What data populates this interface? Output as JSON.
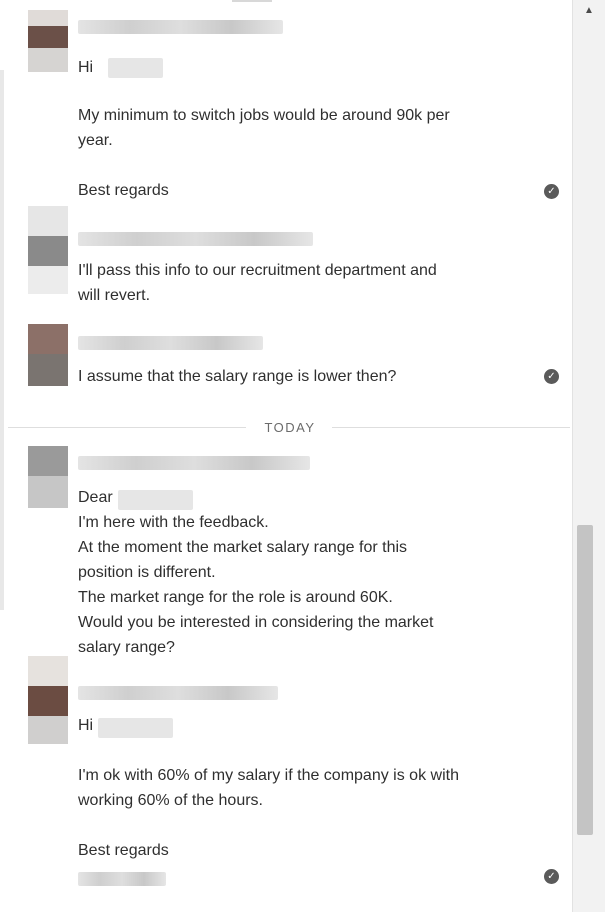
{
  "thread": {
    "messages": [
      {
        "lines": [
          "Hi",
          "",
          "My minimum to switch jobs would be around 90k per",
          "year.",
          "",
          "Best regards"
        ],
        "read": true
      },
      {
        "lines": [
          "I'll pass this info to our recruitment department and",
          "will revert."
        ],
        "read": false
      },
      {
        "lines": [
          "I assume that the salary range is lower then?"
        ],
        "read": true
      },
      {
        "lines": [
          "Dear",
          "I'm here with the feedback.",
          "At the moment the market salary range for this",
          "position is different.",
          "The market range for the role is around 60K.",
          "Would you be interested in considering the market",
          "salary range?"
        ],
        "read": false
      },
      {
        "lines": [
          "Hi",
          "",
          "I'm ok with 60% of my salary if the company is ok with",
          "working 60% of the hours.",
          "",
          "Best regards"
        ],
        "read": true
      }
    ],
    "date_divider": "TODAY"
  },
  "icons": {
    "read_receipt": "check-circle-icon",
    "scroll_up": "arrow-up-icon"
  },
  "colors": {
    "receipt": "#5a5a5a",
    "scroll_thumb": "#c4c4c4"
  },
  "scroll": {
    "position_fraction": 0.78
  }
}
